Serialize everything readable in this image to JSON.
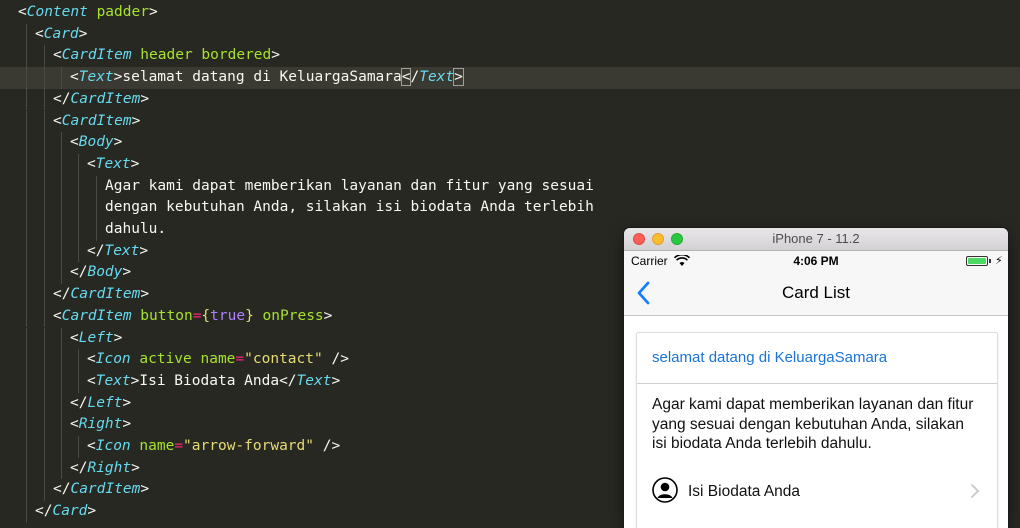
{
  "editor": {
    "lines": [
      {
        "indent": 18,
        "guides": [],
        "tokens": [
          [
            "<",
            "b"
          ],
          [
            "Content",
            "tag"
          ],
          [
            " padder",
            "attr"
          ],
          [
            ">",
            "b"
          ]
        ]
      },
      {
        "indent": 35,
        "guides": [
          26
        ],
        "tokens": [
          [
            "<",
            "b"
          ],
          [
            "Card",
            "tag"
          ],
          [
            ">",
            "b"
          ]
        ]
      },
      {
        "indent": 53,
        "guides": [
          26,
          44
        ],
        "tokens": [
          [
            "<",
            "b"
          ],
          [
            "CardItem",
            "tag"
          ],
          [
            " header bordered",
            "attr"
          ],
          [
            ">",
            "b"
          ]
        ]
      },
      {
        "indent": 70,
        "guides": [
          26,
          44,
          61
        ],
        "active": true,
        "tokens": [
          [
            "<",
            "b"
          ],
          [
            "Text",
            "tag"
          ],
          [
            ">",
            "b"
          ],
          [
            "selamat datang di KeluargaSamara",
            "txt"
          ],
          [
            "<",
            "b",
            "cursor"
          ],
          [
            "/",
            "b"
          ],
          [
            "Text",
            "tag"
          ],
          [
            ">",
            "b",
            "cursor"
          ]
        ]
      },
      {
        "indent": 53,
        "guides": [
          26,
          44
        ],
        "tokens": [
          [
            "</",
            "b"
          ],
          [
            "CardItem",
            "tag"
          ],
          [
            ">",
            "b"
          ]
        ]
      },
      {
        "indent": 53,
        "guides": [
          26,
          44
        ],
        "tokens": [
          [
            "<",
            "b"
          ],
          [
            "CardItem",
            "tag"
          ],
          [
            ">",
            "b"
          ]
        ]
      },
      {
        "indent": 70,
        "guides": [
          26,
          44,
          61
        ],
        "tokens": [
          [
            "<",
            "b"
          ],
          [
            "Body",
            "tag"
          ],
          [
            ">",
            "b"
          ]
        ]
      },
      {
        "indent": 87,
        "guides": [
          26,
          44,
          61,
          78
        ],
        "tokens": [
          [
            "<",
            "b"
          ],
          [
            "Text",
            "tag"
          ],
          [
            ">",
            "b"
          ]
        ]
      },
      {
        "indent": 105,
        "guides": [
          26,
          44,
          61,
          78,
          96
        ],
        "tokens": [
          [
            "Agar kami dapat memberikan layanan dan fitur yang sesuai",
            "txt"
          ]
        ]
      },
      {
        "indent": 105,
        "guides": [
          26,
          44,
          61,
          78,
          96
        ],
        "tokens": [
          [
            "dengan kebutuhan Anda, silakan isi biodata Anda terlebih",
            "txt"
          ]
        ]
      },
      {
        "indent": 105,
        "guides": [
          26,
          44,
          61,
          78,
          96
        ],
        "tokens": [
          [
            "dahulu.",
            "txt"
          ]
        ]
      },
      {
        "indent": 87,
        "guides": [
          26,
          44,
          61,
          78
        ],
        "tokens": [
          [
            "</",
            "b"
          ],
          [
            "Text",
            "tag"
          ],
          [
            ">",
            "b"
          ]
        ]
      },
      {
        "indent": 70,
        "guides": [
          26,
          44,
          61
        ],
        "tokens": [
          [
            "</",
            "b"
          ],
          [
            "Body",
            "tag"
          ],
          [
            ">",
            "b"
          ]
        ]
      },
      {
        "indent": 53,
        "guides": [
          26,
          44
        ],
        "tokens": [
          [
            "</",
            "b"
          ],
          [
            "CardItem",
            "tag"
          ],
          [
            ">",
            "b"
          ]
        ]
      },
      {
        "indent": 53,
        "guides": [
          26,
          44
        ],
        "tokens": [
          [
            "<",
            "b"
          ],
          [
            "CardItem",
            "tag"
          ],
          [
            " button",
            "attr"
          ],
          [
            "=",
            "eq"
          ],
          [
            "{",
            "str"
          ],
          [
            "true",
            "kw"
          ],
          [
            "}",
            "str"
          ],
          [
            " onPress",
            "attr"
          ],
          [
            ">",
            "b"
          ]
        ]
      },
      {
        "indent": 70,
        "guides": [
          26,
          44,
          61
        ],
        "tokens": [
          [
            "<",
            "b"
          ],
          [
            "Left",
            "tag"
          ],
          [
            ">",
            "b"
          ]
        ]
      },
      {
        "indent": 87,
        "guides": [
          26,
          44,
          61,
          78
        ],
        "tokens": [
          [
            "<",
            "b"
          ],
          [
            "Icon",
            "tag"
          ],
          [
            " active name",
            "attr"
          ],
          [
            "=",
            "eq"
          ],
          [
            "\"contact\"",
            "str"
          ],
          [
            " />",
            "b"
          ]
        ]
      },
      {
        "indent": 87,
        "guides": [
          26,
          44,
          61,
          78
        ],
        "tokens": [
          [
            "<",
            "b"
          ],
          [
            "Text",
            "tag"
          ],
          [
            ">",
            "b"
          ],
          [
            "Isi Biodata Anda",
            "txt"
          ],
          [
            "</",
            "b"
          ],
          [
            "Text",
            "tag"
          ],
          [
            ">",
            "b"
          ]
        ]
      },
      {
        "indent": 70,
        "guides": [
          26,
          44,
          61
        ],
        "tokens": [
          [
            "</",
            "b"
          ],
          [
            "Left",
            "tag"
          ],
          [
            ">",
            "b"
          ]
        ]
      },
      {
        "indent": 70,
        "guides": [
          26,
          44,
          61
        ],
        "tokens": [
          [
            "<",
            "b"
          ],
          [
            "Right",
            "tag"
          ],
          [
            ">",
            "b"
          ]
        ]
      },
      {
        "indent": 87,
        "guides": [
          26,
          44,
          61,
          78
        ],
        "tokens": [
          [
            "<",
            "b"
          ],
          [
            "Icon",
            "tag"
          ],
          [
            " name",
            "attr"
          ],
          [
            "=",
            "eq"
          ],
          [
            "\"arrow-forward\"",
            "str"
          ],
          [
            " />",
            "b"
          ]
        ]
      },
      {
        "indent": 70,
        "guides": [
          26,
          44,
          61
        ],
        "tokens": [
          [
            "</",
            "b"
          ],
          [
            "Right",
            "tag"
          ],
          [
            ">",
            "b"
          ]
        ]
      },
      {
        "indent": 53,
        "guides": [
          26,
          44
        ],
        "tokens": [
          [
            "</",
            "b"
          ],
          [
            "CardItem",
            "tag"
          ],
          [
            ">",
            "b"
          ]
        ]
      },
      {
        "indent": 35,
        "guides": [
          26
        ],
        "tokens": [
          [
            "</",
            "b"
          ],
          [
            "Card",
            "tag"
          ],
          [
            ">",
            "b"
          ]
        ]
      }
    ]
  },
  "simulator": {
    "window_title": "iPhone 7 - 11.2",
    "status": {
      "carrier": "Carrier",
      "time": "4:06 PM",
      "charging": "⚡"
    },
    "nav": {
      "title": "Card List"
    },
    "card": {
      "header": "selamat datang di KeluargaSamara",
      "body": "Agar kami dapat memberikan layanan dan fitur yang sesuai dengan kebutuhan Anda, silakan isi biodata Anda terlebih dahulu.",
      "button_label": "Isi Biodata Anda"
    }
  },
  "icons": {
    "contact": "contact-icon",
    "arrow_forward": "chevron-right-icon",
    "back": "back-arrow-icon"
  },
  "colors": {
    "editor_bg": "#272822",
    "tag": "#66d9ef",
    "attr": "#a6e22e",
    "string": "#e6db74",
    "operator": "#f92672",
    "keyword": "#ae81ff",
    "link_blue": "#1a73d8"
  }
}
